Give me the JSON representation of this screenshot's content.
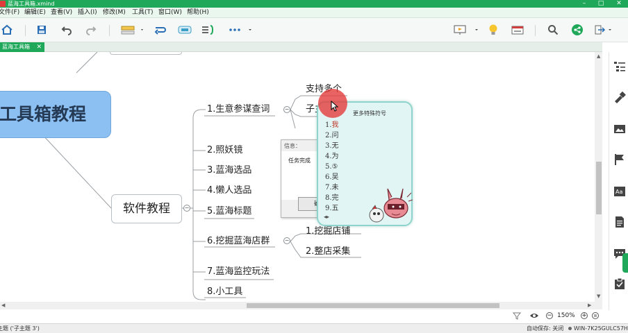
{
  "window": {
    "title": "蓝海工具箱.xmind",
    "controls": [
      "minimize",
      "maximize",
      "close"
    ]
  },
  "menu": [
    "文件(F)",
    "编辑(E)",
    "查看(V)",
    "插入(I)",
    "修改(M)",
    "工具(T)",
    "窗口(W)",
    "帮助(H)"
  ],
  "toolbar": {
    "icons": [
      "home-icon",
      "save-icon",
      "undo-icon",
      "redo-icon",
      "topic-style-icon",
      "relationship-icon",
      "boundary-icon",
      "summary-icon",
      "more-icon",
      "presentation-icon",
      "idea-icon",
      "panel-icon",
      "search-icon",
      "share-icon",
      "export-icon"
    ]
  },
  "doc_tab": {
    "label": "蓝海工具箱",
    "close": "✕"
  },
  "mindmap": {
    "central": "工具箱教程",
    "main_topic": "软件教程",
    "subtopics": [
      "1.生意参谋查词",
      "2.照妖镜",
      "3.蓝海选品",
      "4.懒人选品",
      "5.蓝海标题",
      "6.挖掘蓝海店群",
      "7.蓝海监控玩法",
      "8.小工具"
    ],
    "subtopic1_children": [
      "支持多个",
      "子主",
      "子"
    ],
    "subtopic6_children": [
      "1.挖掘店铺",
      "2.整店采集"
    ],
    "collapse_symbol": "−"
  },
  "dialog": {
    "title": "信息：",
    "message": "任务完成",
    "button_text": "确"
  },
  "symbol_popup": {
    "title": "更多特殊符号",
    "items": [
      {
        "num": "1.",
        "char": "我"
      },
      {
        "num": "2.",
        "char": "问"
      },
      {
        "num": "3.",
        "char": "无"
      },
      {
        "num": "4.",
        "char": "为"
      },
      {
        "num": "5.",
        "char": "⑤"
      },
      {
        "num": "6.",
        "char": "吴"
      },
      {
        "num": "7.",
        "char": "未"
      },
      {
        "num": "8.",
        "char": "完"
      },
      {
        "num": "9.",
        "char": "五"
      }
    ],
    "nav": "◂▸"
  },
  "zoom": {
    "level": "150%",
    "minus": "−",
    "plus": "+"
  },
  "status": {
    "left": "主题 ('子主题 3')",
    "autosave": "自动保存: 关闭",
    "machine": "WIN-7K25GULC57H"
  },
  "colors": {
    "accent": "#1fa85a",
    "central_fill": "#8cc0f2",
    "popup_fill": "#e1f6f4",
    "selection": "#3f5fa5"
  }
}
